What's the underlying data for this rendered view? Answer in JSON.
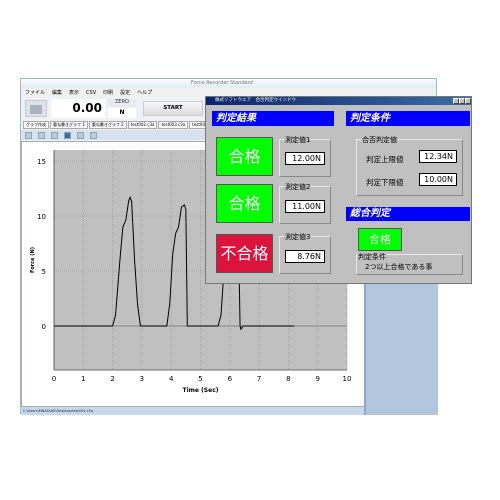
{
  "app": {
    "title": "Force Recorder Standard",
    "menu": [
      "ファイル",
      "編集",
      "表示",
      "CSV",
      "印刷",
      "設定",
      "ヘルプ"
    ],
    "readout": "0.00",
    "zero_label": "ZERO",
    "unit": "N",
    "start_label": "START",
    "tabs": [
      "グラフ作成",
      "重ね書きグラフ 1",
      "重ね書きグラフ 2",
      "test002.c3a",
      "test003.c3a",
      "test004.c3a"
    ],
    "status_path": "C:\\Users\\MNAD\\AE\\Desktop\\test004.c3a"
  },
  "chart_data": {
    "type": "line",
    "xlabel": "Time (Sec)",
    "ylabel": "Force (N)",
    "xlim": [
      0,
      10
    ],
    "ylim": [
      -4,
      16
    ],
    "grid": true,
    "x_ticks": [
      0,
      1,
      2,
      3,
      4,
      5,
      6,
      7,
      8,
      9,
      10
    ],
    "y_ticks": [
      0,
      5,
      10,
      15
    ],
    "points": [
      [
        0,
        0
      ],
      [
        2.0,
        0
      ],
      [
        2.1,
        1
      ],
      [
        2.25,
        6
      ],
      [
        2.35,
        9
      ],
      [
        2.45,
        9.6
      ],
      [
        2.55,
        11.4
      ],
      [
        2.6,
        11.7
      ],
      [
        2.65,
        11.3
      ],
      [
        2.75,
        6
      ],
      [
        2.85,
        2
      ],
      [
        2.95,
        0
      ],
      [
        3.85,
        0
      ],
      [
        3.95,
        2
      ],
      [
        4.05,
        6.5
      ],
      [
        4.15,
        8.4
      ],
      [
        4.25,
        9
      ],
      [
        4.35,
        10.8
      ],
      [
        4.45,
        11
      ],
      [
        4.5,
        10.6
      ],
      [
        4.55,
        0
      ],
      [
        5.6,
        0
      ],
      [
        5.7,
        1
      ],
      [
        5.8,
        5
      ],
      [
        5.9,
        7.5
      ],
      [
        6.05,
        8.4
      ],
      [
        6.2,
        8.76
      ],
      [
        6.3,
        8
      ],
      [
        6.35,
        0
      ],
      [
        6.38,
        -0.3
      ],
      [
        6.45,
        0
      ],
      [
        8.2,
        0
      ]
    ]
  },
  "dialog": {
    "title": "株式ソフトウエア　合否判定ウインドウ",
    "result_header": "判定結果",
    "condition_header": "判定条件",
    "total_header": "総合判定",
    "results": [
      {
        "label": "測定値1",
        "value": "12.00N",
        "verdict": "合格",
        "color": "#00ff00"
      },
      {
        "label": "測定値2",
        "value": "11.00N",
        "verdict": "合格",
        "color": "#00ff00"
      },
      {
        "label": "測定値3",
        "value": "8.76N",
        "verdict": "不合格",
        "color": "#dc143c"
      }
    ],
    "threshold_group": "合否判定値",
    "upper_label": "判定上限値",
    "upper_value": "12.34N",
    "lower_label": "判定下限値",
    "lower_value": "10.00N",
    "total_verdict": "合格",
    "total_color": "#00ff00",
    "rule_label": "判定条件",
    "rule_text": "2つ以上合格である事"
  }
}
